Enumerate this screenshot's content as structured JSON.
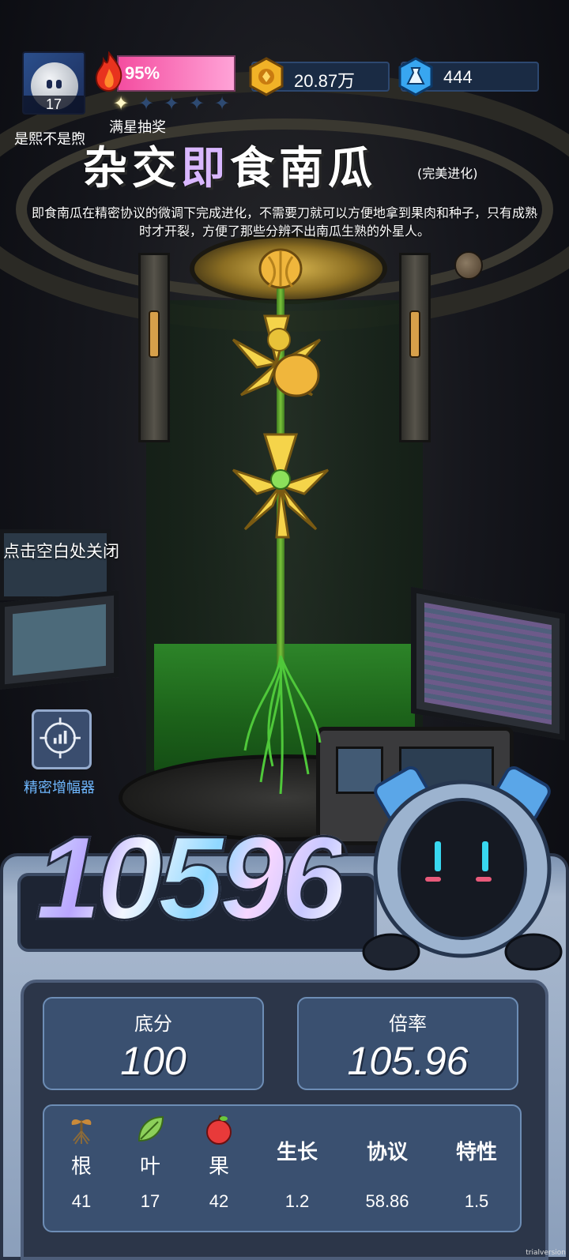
{
  "player": {
    "level": "17",
    "name": "是熙不是煦"
  },
  "hp": {
    "percent_text": "95%"
  },
  "stars": {
    "filled": 1,
    "total": 5,
    "label": "满星抽奖"
  },
  "currency": {
    "gold": "20.87万",
    "gems": "444"
  },
  "item": {
    "title": "杂交即食南瓜",
    "title_highlight": "即",
    "tag": "(完美进化)",
    "description": "即食南瓜在精密协议的微调下完成进化，不需要刀就可以方便地拿到果肉和种子，只有成熟时才开裂，方便了那些分辨不出南瓜生熟的外星人。"
  },
  "hint": {
    "close": "点击空白处关闭"
  },
  "amplifier": {
    "label": "精密增幅器",
    "icon": "target-chart-icon"
  },
  "score": {
    "total": "10596"
  },
  "stats": {
    "base_label": "底分",
    "base_value": "100",
    "multiplier_label": "倍率",
    "multiplier_value": "105.96"
  },
  "attributes": [
    {
      "key": "root",
      "label": "根",
      "value": "41",
      "icon": "sprout-icon"
    },
    {
      "key": "leaf",
      "label": "叶",
      "value": "17",
      "icon": "leaf-icon"
    },
    {
      "key": "fruit",
      "label": "果",
      "value": "42",
      "icon": "apple-icon"
    },
    {
      "key": "growth",
      "label": "生长",
      "value": "1.2"
    },
    {
      "key": "protocol",
      "label": "协议",
      "value": "58.86"
    },
    {
      "key": "trait",
      "label": "特性",
      "value": "1.5"
    }
  ],
  "watermark": "trialversion",
  "colors": {
    "hp_bar": "#f44da0",
    "amp_label": "#6fb8ff",
    "liquid": "#2f8f2a",
    "flower": "#f5d44a"
  }
}
